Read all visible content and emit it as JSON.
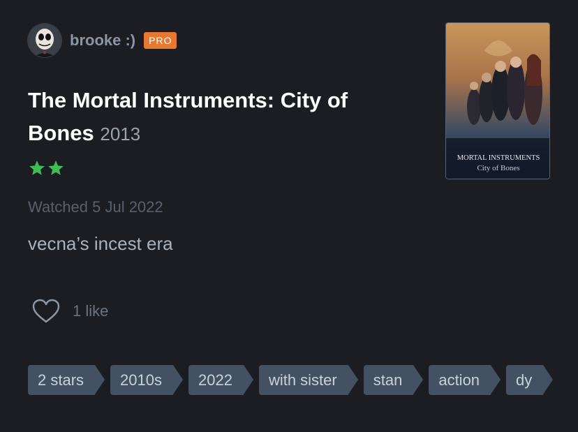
{
  "user": {
    "name": "brooke :)",
    "badge": "PRO"
  },
  "film": {
    "title": "The Mortal Instruments: City of Bones",
    "year": "2013",
    "rating_stars": 2,
    "rating_max": 5,
    "poster_text_line1": "MORTAL INSTRUMENTS",
    "poster_text_line2": "City of Bones"
  },
  "watched": "Watched 5 Jul 2022",
  "review": "vecna’s incest era",
  "likes": "1 like",
  "tags": [
    {
      "label": "2 stars"
    },
    {
      "label": "2010s"
    },
    {
      "label": "2022"
    },
    {
      "label": "with sister"
    },
    {
      "label": "stan"
    },
    {
      "label": "action"
    },
    {
      "label": "dy"
    }
  ],
  "colors": {
    "background": "#1b1d22",
    "star": "#40bc56",
    "pro_badge": "#e7782e",
    "tag": "#445162"
  }
}
